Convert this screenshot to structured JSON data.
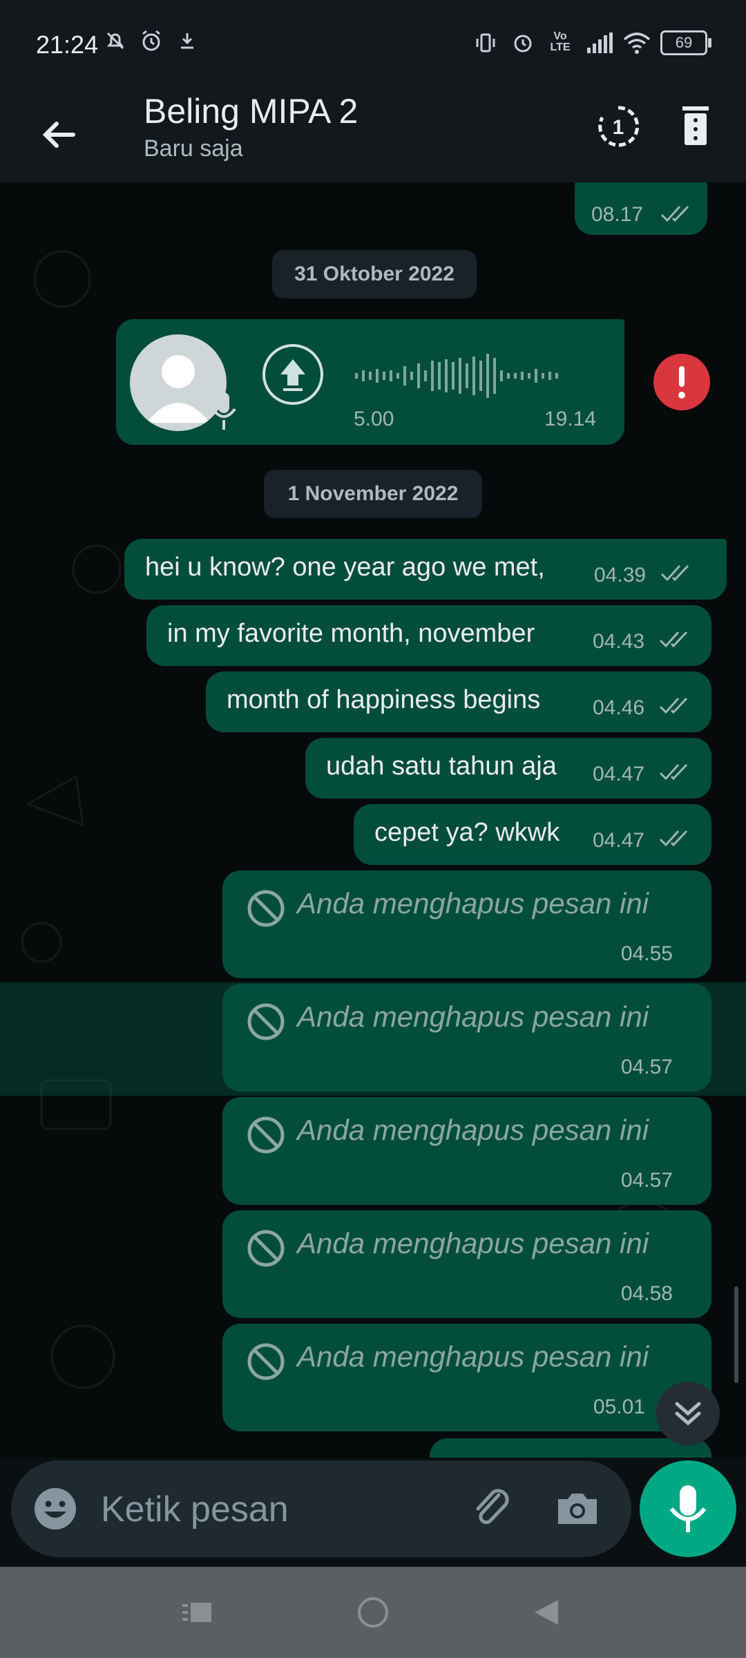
{
  "status": {
    "time": "21:24",
    "battery": "69",
    "icons_left": [
      "muted-notification-icon",
      "alarm-icon",
      "download-icon"
    ],
    "icons_right": [
      "vibrate-icon",
      "alarm-icon",
      "volte-icon",
      "signal-icon",
      "wifi-icon",
      "battery-icon"
    ]
  },
  "header": {
    "title": "Beling MIPA 2",
    "subtitle": "Baru saja"
  },
  "messages": {
    "top_time": "08.17",
    "date1": "31 Oktober 2022",
    "voice": {
      "duration": "5.00",
      "time": "19.14"
    },
    "date2": "1 November 2022",
    "texts": [
      {
        "text": "hei u know? one year ago we met,",
        "time": "04.39"
      },
      {
        "text": "in my favorite month, november",
        "time": "04.43"
      },
      {
        "text": "month of happiness begins",
        "time": "04.46"
      },
      {
        "text": "udah satu tahun aja",
        "time": "04.47"
      },
      {
        "text": "cepet ya? wkwk",
        "time": "04.47"
      }
    ],
    "deleted": [
      {
        "text": "Anda menghapus pesan ini",
        "time": "04.55"
      },
      {
        "text": "Anda menghapus pesan ini",
        "time": "04.57"
      },
      {
        "text": "Anda menghapus pesan ini",
        "time": "04.57"
      },
      {
        "text": "Anda menghapus pesan ini",
        "time": "04.58"
      },
      {
        "text": "Anda menghapus pesan ini",
        "time": "05.01"
      }
    ]
  },
  "input": {
    "placeholder": "Ketik pesan"
  },
  "colors": {
    "bubble": "#034d3b",
    "accent": "#00a884",
    "error": "#d9363e",
    "header": "#12181c"
  }
}
